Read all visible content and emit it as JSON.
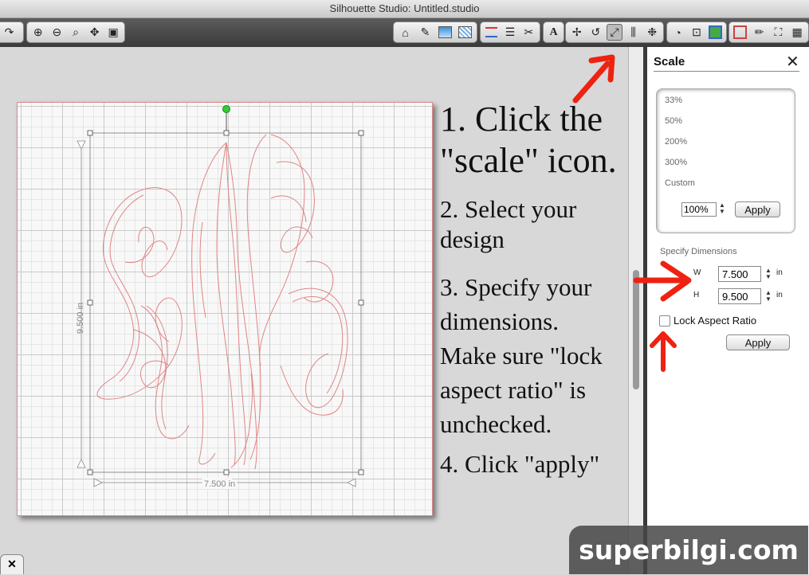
{
  "window": {
    "title": "Silhouette Studio: Untitled.studio"
  },
  "toolbar": {
    "groups": [
      {
        "name": "redo",
        "icons": [
          "redo-icon"
        ]
      },
      {
        "name": "zoom",
        "icons": [
          "zoom-in-icon",
          "zoom-out-icon",
          "zoom-select-icon",
          "pan-icon",
          "fit-page-icon"
        ]
      },
      {
        "name": "panels",
        "icons": [
          "page-setup-icon",
          "fill-color-icon",
          "fill-gradient-icon",
          "fill-pattern-icon"
        ]
      },
      {
        "name": "line",
        "icons": [
          "line-color-icon",
          "line-style-icon",
          "cut-style-icon"
        ]
      },
      {
        "name": "text",
        "icons": [
          "text-style-icon"
        ]
      },
      {
        "name": "transform",
        "icons": [
          "transform-icon",
          "rotate-icon",
          "scale-icon",
          "align-icon",
          "replicate-icon"
        ]
      },
      {
        "name": "window",
        "icons": [
          "store-icon",
          "library-icon",
          "settings-icon"
        ]
      },
      {
        "name": "view",
        "icons": [
          "print-border-icon",
          "pen-icon",
          "fullscreen-icon",
          "grid-icon"
        ]
      }
    ]
  },
  "design": {
    "height_label": "9.500 in",
    "width_label": "7.500 in",
    "outline_color": "#e08585"
  },
  "instructions": {
    "step1": [
      "1. Click the",
      "\"scale\" icon."
    ],
    "step2": [
      "2. Select your",
      "design"
    ],
    "step3": [
      "3. Specify your",
      "dimensions.",
      "Make sure \"lock",
      "aspect ratio\" is",
      "unchecked."
    ],
    "step4": "4. Click \"apply\""
  },
  "scale_panel": {
    "title": "Scale",
    "presets": [
      "33%",
      "50%",
      "200%",
      "300%",
      "Custom"
    ],
    "custom_value": "100%",
    "apply_label": "Apply",
    "dimensions_title": "Specify Dimensions",
    "width_letter": "W",
    "height_letter": "H",
    "width_value": "7.500",
    "height_value": "9.500",
    "unit": "in",
    "lock_aspect_label": "Lock Aspect Ratio",
    "lock_aspect_checked": false,
    "apply_dimensions_label": "Apply"
  },
  "watermark": "superbilgi.com",
  "annotation_color": "#ee2211"
}
